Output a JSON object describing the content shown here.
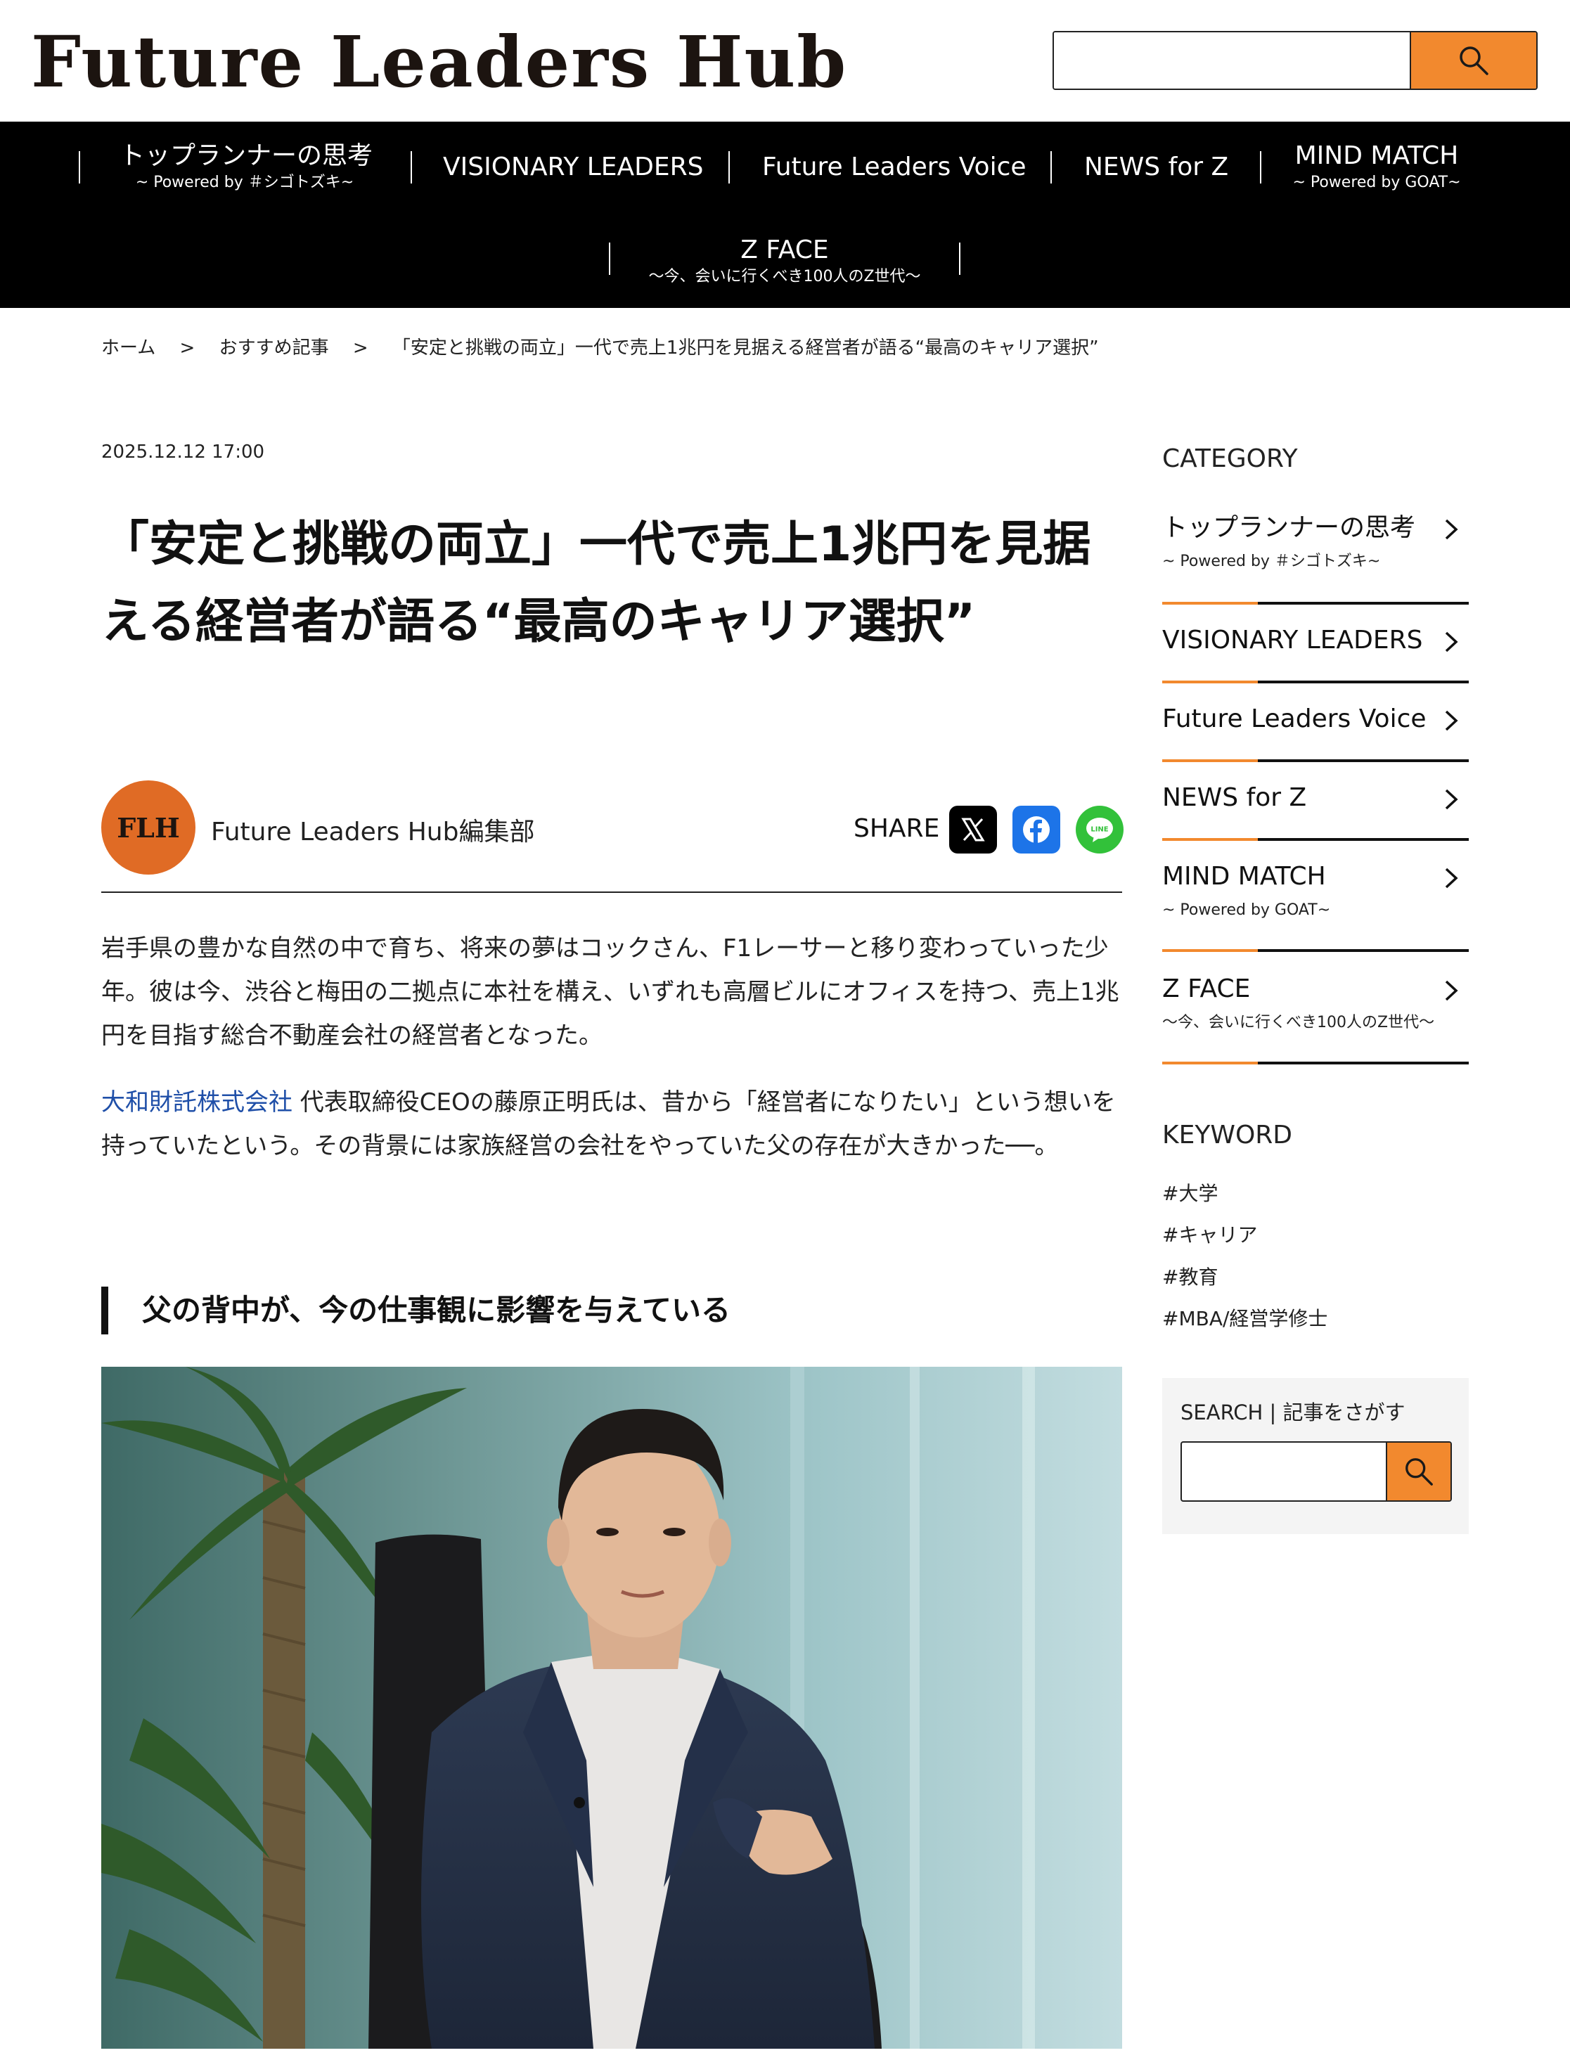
{
  "site": {
    "logo": "Future Leaders Hub"
  },
  "header_search": {
    "placeholder": ""
  },
  "nav": {
    "items": [
      {
        "label": "トップランナーの思考",
        "sub": "~ Powered by ＃シゴトズキ~"
      },
      {
        "label": "VISIONARY LEADERS",
        "sub": ""
      },
      {
        "label": "Future Leaders Voice",
        "sub": ""
      },
      {
        "label": "NEWS for Z",
        "sub": ""
      },
      {
        "label": "MIND MATCH",
        "sub": "~ Powered by GOAT~"
      },
      {
        "label": "Z FACE",
        "sub": "〜今、会いに行くべき100人のZ世代〜"
      }
    ]
  },
  "breadcrumb": {
    "home": "ホーム",
    "sep": ">",
    "category": "おすすめ記事",
    "current": "「安定と挑戦の両立」一代で売上1兆円を見据える経営者が語る“最高のキャリア選択”"
  },
  "article": {
    "date": "2025.12.12 17:00",
    "title": "「安定と挑戦の両立」一代で売上1兆円を見据える経営者が語る“最高のキャリア選択”",
    "author_initials": "FLH",
    "author_name": "Future Leaders Hub編集部",
    "share_label": "SHARE",
    "para1": "岩手県の豊かな自然の中で育ち、将来の夢はコックさん、F1レーサーと移り変わっていった少年。彼は今、渋谷と梅田の二拠点に本社を構え、いずれも高層ビルにオフィスを持つ、売上1兆円を目指す総合不動産会社の経営者となった。",
    "para2_link": "大和財託株式会社",
    "para2_rest": " 代表取締役CEOの藤原正明氏は、昔から「経営者になりたい」という想いを持っていたという。その背景には家族経営の会社をやっていた父の存在が大きかった──。",
    "section_heading": "父の背中が、今の仕事観に影響を与えている"
  },
  "sidebar": {
    "category_heading": "CATEGORY",
    "categories": [
      {
        "label": "トップランナーの思考",
        "sub": "~ Powered by ＃シゴトズキ~"
      },
      {
        "label": "VISIONARY LEADERS",
        "sub": ""
      },
      {
        "label": "Future Leaders Voice",
        "sub": ""
      },
      {
        "label": "NEWS for Z",
        "sub": ""
      },
      {
        "label": "MIND MATCH",
        "sub": "~ Powered by GOAT~"
      },
      {
        "label": "Z FACE",
        "sub": "〜今、会いに行くべき100人のZ世代〜"
      }
    ],
    "keyword_heading": "KEYWORD",
    "keywords": [
      "#大学",
      "#キャリア",
      "#教育",
      "#MBA/経営学修士"
    ],
    "search_label": "SEARCH | 記事をさがす"
  },
  "colors": {
    "accent": "#f2892e",
    "link": "#1f4fa8",
    "nav_bg": "#000000"
  },
  "icons": {
    "search": "magnifier-icon",
    "x": "x-logo-icon",
    "facebook": "facebook-icon",
    "line": "line-icon",
    "chevron": "chevron-right-icon"
  }
}
